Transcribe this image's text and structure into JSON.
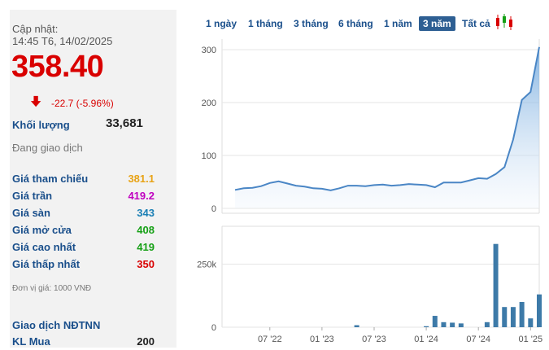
{
  "info": {
    "updated_label": "Cập nhật:",
    "updated_time": "14:45 T6, 14/02/2025",
    "price": "358.40",
    "change": "-22.7 (-5.96%)",
    "volume_label": "Khối lượng",
    "volume_value": "33,681",
    "status": "Đang giao dịch",
    "rows": [
      {
        "label": "Giá tham chiếu",
        "value": "381.1",
        "color": "#e8a316"
      },
      {
        "label": "Giá trần",
        "value": "419.2",
        "color": "#c000c0"
      },
      {
        "label": "Giá sàn",
        "value": "343",
        "color": "#1a7fb5"
      },
      {
        "label": "Giá mở cửa",
        "value": "408",
        "color": "#15a015"
      },
      {
        "label": "Giá cao nhất",
        "value": "419",
        "color": "#15a015"
      },
      {
        "label": "Giá thấp nhất",
        "value": "350",
        "color": "#d90000"
      }
    ],
    "unit_note": "Đơn vị giá: 1000 VNĐ",
    "foreign_title": "Giao dịch NĐTNN",
    "foreign_buy_label": "KL Mua",
    "foreign_buy_value": "200"
  },
  "ranges": [
    "1 ngày",
    "1 tháng",
    "3 tháng",
    "6 tháng",
    "1 năm",
    "3 năm",
    "Tất cả"
  ],
  "active_range": "3 năm",
  "colors": {
    "price_down": "#d90000",
    "link": "#1a4f8b",
    "line": "#4a86c5",
    "bar": "#3d7aa8"
  },
  "chart_data": [
    {
      "type": "area",
      "title": "",
      "x": [
        "2022-03",
        "2022-04",
        "2022-05",
        "2022-06",
        "2022-07",
        "2022-08",
        "2022-09",
        "2022-10",
        "2022-11",
        "2022-12",
        "2023-01",
        "2023-02",
        "2023-03",
        "2023-04",
        "2023-05",
        "2023-06",
        "2023-07",
        "2023-08",
        "2023-09",
        "2023-10",
        "2023-11",
        "2023-12",
        "2024-01",
        "2024-02",
        "2024-03",
        "2024-04",
        "2024-05",
        "2024-06",
        "2024-07",
        "2024-08",
        "2024-09",
        "2024-10",
        "2024-11",
        "2024-12",
        "2025-01",
        "2025-02"
      ],
      "y": [
        35,
        38,
        39,
        42,
        48,
        51,
        47,
        43,
        41,
        38,
        37,
        34,
        38,
        43,
        43,
        42,
        44,
        45,
        43,
        44,
        46,
        45,
        44,
        40,
        49,
        49,
        49,
        53,
        57,
        56,
        65,
        78,
        130,
        205,
        220,
        305
      ],
      "yticks": [
        0,
        100,
        200,
        300
      ],
      "ylim": [
        0,
        320
      ],
      "grid": true
    },
    {
      "type": "bar",
      "title": "",
      "x": [
        "2023-05",
        "2024-01",
        "2024-02",
        "2024-03",
        "2024-04",
        "2024-05",
        "2024-08",
        "2024-09",
        "2024-10",
        "2024-11",
        "2024-12",
        "2025-01",
        "2025-02"
      ],
      "values": [
        8000,
        4000,
        45000,
        20000,
        18000,
        15000,
        20000,
        330000,
        80000,
        80000,
        100000,
        35000,
        130000
      ],
      "yticks_labels": [
        "0",
        "250k"
      ],
      "yticks": [
        0,
        250000
      ],
      "ylim": [
        0,
        400000
      ],
      "xticks": [
        "07 '22",
        "01 '23",
        "07 '23",
        "01 '24",
        "07 '24",
        "01 '25"
      ]
    }
  ]
}
